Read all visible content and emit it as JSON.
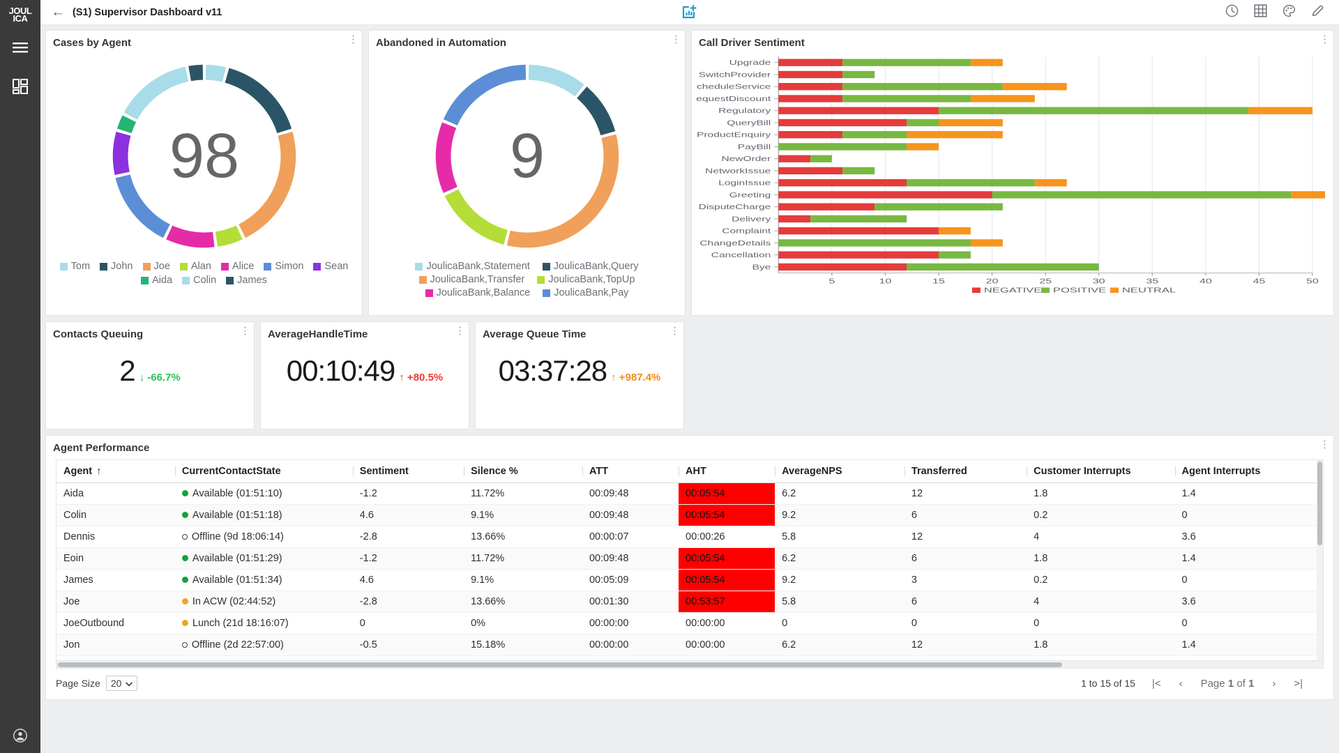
{
  "brand": {
    "logo_line1": "JOUL",
    "logo_line2": "ICA"
  },
  "rail": {
    "menu_icon": "hamburger-menu-icon",
    "dashboards_icon": "dashboard-grid-icon",
    "account_icon": "user-account-icon"
  },
  "topbar": {
    "back_label": "←",
    "title": "(S1) Supervisor Dashboard v11",
    "center_icon": "add-chart-icon",
    "center_icon_color": "#1b9fd0",
    "actions": [
      {
        "name": "clock-icon",
        "label": "history"
      },
      {
        "name": "grid-icon",
        "label": "layout"
      },
      {
        "name": "palette-icon",
        "label": "theme"
      },
      {
        "name": "pencil-icon",
        "label": "edit"
      }
    ]
  },
  "cards": {
    "cases_by_agent": {
      "title": "Cases by Agent"
    },
    "abandoned": {
      "title": "Abandoned in Automation"
    },
    "sentiment": {
      "title": "Call Driver Sentiment"
    },
    "agent_performance": {
      "title": "Agent Performance"
    }
  },
  "kpis": [
    {
      "title": "Contacts Queuing",
      "value": "2",
      "delta": "-66.7%",
      "arrow": "↓",
      "delta_color": "#23c552"
    },
    {
      "title": "AverageHandleTime",
      "value": "00:10:49",
      "delta": "+80.5%",
      "arrow": "↑",
      "delta_color": "#ef3b36"
    },
    {
      "title": "Average Queue Time",
      "value": "03:37:28",
      "delta": "+987.4%",
      "arrow": "↑",
      "delta_color": "#f08c1b"
    }
  ],
  "chart_data": [
    {
      "type": "pie",
      "title": "Cases by Agent",
      "center_value": "98",
      "legend_position": "bottom",
      "labels": [
        "Tom",
        "John",
        "Joe",
        "Alan",
        "Alice",
        "Simon",
        "Sean",
        "Aida",
        "Colin",
        "James"
      ],
      "values": [
        4,
        16,
        22,
        5,
        9,
        14,
        8,
        3,
        14,
        3
      ],
      "colors": [
        "#a8dce8",
        "#2b5566",
        "#f0a05a",
        "#b4dd38",
        "#e62ba8",
        "#5b8ed6",
        "#8c31e0",
        "#22b573",
        "#a8dce8",
        "#2b5566"
      ]
    },
    {
      "type": "pie",
      "title": "Abandoned in Automation",
      "center_value": "9",
      "legend_position": "bottom",
      "labels": [
        "JoulicaBank,Statement",
        "JoulicaBank,Query",
        "JoulicaBank,Transfer",
        "JoulicaBank,TopUp",
        "JoulicaBank,Balance",
        "JoulicaBank,Pay"
      ],
      "values": [
        10,
        9,
        30,
        13,
        12,
        17
      ],
      "colors": [
        "#a8dce8",
        "#2b5566",
        "#f0a05a",
        "#b4dd38",
        "#e62ba8",
        "#5b8ed6"
      ]
    },
    {
      "type": "bar",
      "orientation": "horizontal",
      "stacked": true,
      "title": "Call Driver Sentiment",
      "xlabel": "",
      "ylabel": "",
      "xlim": [
        0,
        50
      ],
      "xticks": [
        5,
        10,
        15,
        20,
        25,
        30,
        35,
        40,
        45,
        50
      ],
      "grid": true,
      "legend_position": "bottom",
      "categories": [
        "Upgrade",
        "SwitchProvider",
        "ScheduleService",
        "RequestDiscount",
        "Regulatory",
        "QueryBill",
        "ProductEnquiry",
        "PayBill",
        "NewOrder",
        "NetworkIssue",
        "LoginIssue",
        "Greeting",
        "DisputeCharge",
        "Delivery",
        "Complaint",
        "ChangeDetails",
        "Cancellation",
        "Bye"
      ],
      "series": [
        {
          "name": "NEGATIVE",
          "color": "#e43b3b",
          "values": [
            6,
            6,
            6,
            6,
            15,
            12,
            6,
            0,
            3,
            6,
            12,
            20,
            9,
            3,
            15,
            0,
            15,
            12
          ]
        },
        {
          "name": "POSITIVE",
          "color": "#78b842",
          "values": [
            12,
            3,
            15,
            12,
            29,
            3,
            6,
            12,
            2,
            3,
            12,
            28,
            12,
            9,
            0,
            18,
            3,
            18
          ]
        },
        {
          "name": "NEUTRAL",
          "color": "#f7941d",
          "values": [
            3,
            0,
            6,
            6,
            6,
            6,
            9,
            3,
            0,
            0,
            3,
            5,
            0,
            0,
            3,
            3,
            0,
            0
          ]
        }
      ]
    }
  ],
  "table": {
    "columns": [
      "Agent",
      "CurrentContactState",
      "Sentiment",
      "Silence %",
      "ATT",
      "AHT",
      "AverageNPS",
      "Transferred",
      "Customer Interrupts",
      "Agent Interrupts"
    ],
    "sort_column": "Agent",
    "sort_arrow": "↑",
    "rows": [
      {
        "agent": "Aida",
        "state": "Available (01:51:10)",
        "state_dot": "green",
        "sentiment": "-1.2",
        "silence": "11.72%",
        "att": "00:09:48",
        "aht": "00:05:54",
        "aht_alert": true,
        "nps": "6.2",
        "transferred": "12",
        "cust_int": "1.8",
        "agent_int": "1.4"
      },
      {
        "agent": "Colin",
        "state": "Available (01:51:18)",
        "state_dot": "green",
        "sentiment": "4.6",
        "silence": "9.1%",
        "att": "00:09:48",
        "aht": "00:05:54",
        "aht_alert": true,
        "nps": "9.2",
        "transferred": "6",
        "cust_int": "0.2",
        "agent_int": "0"
      },
      {
        "agent": "Dennis",
        "state": "Offline (9d 18:06:14)",
        "state_dot": "hollow",
        "sentiment": "-2.8",
        "silence": "13.66%",
        "att": "00:00:07",
        "aht": "00:00:26",
        "aht_alert": false,
        "nps": "5.8",
        "transferred": "12",
        "cust_int": "4",
        "agent_int": "3.6"
      },
      {
        "agent": "Eoin",
        "state": "Available (01:51:29)",
        "state_dot": "green",
        "sentiment": "-1.2",
        "silence": "11.72%",
        "att": "00:09:48",
        "aht": "00:05:54",
        "aht_alert": true,
        "nps": "6.2",
        "transferred": "6",
        "cust_int": "1.8",
        "agent_int": "1.4"
      },
      {
        "agent": "James",
        "state": "Available (01:51:34)",
        "state_dot": "green",
        "sentiment": "4.6",
        "silence": "9.1%",
        "att": "00:05:09",
        "aht": "00:05:54",
        "aht_alert": true,
        "nps": "9.2",
        "transferred": "3",
        "cust_int": "0.2",
        "agent_int": "0"
      },
      {
        "agent": "Joe",
        "state": "In ACW (02:44:52)",
        "state_dot": "orange",
        "sentiment": "-2.8",
        "silence": "13.66%",
        "att": "00:01:30",
        "aht": "00:53:57",
        "aht_alert": true,
        "nps": "5.8",
        "transferred": "6",
        "cust_int": "4",
        "agent_int": "3.6"
      },
      {
        "agent": "JoeOutbound",
        "state": "Lunch (21d 18:16:07)",
        "state_dot": "orange",
        "sentiment": "0",
        "silence": "0%",
        "att": "00:00:00",
        "aht": "00:00:00",
        "aht_alert": false,
        "nps": "0",
        "transferred": "0",
        "cust_int": "0",
        "agent_int": "0"
      },
      {
        "agent": "Jon",
        "state": "Offline (2d 22:57:00)",
        "state_dot": "hollow",
        "sentiment": "-0.5",
        "silence": "15.18%",
        "att": "00:00:00",
        "aht": "00:00:00",
        "aht_alert": false,
        "nps": "6.2",
        "transferred": "12",
        "cust_int": "1.8",
        "agent_int": "1.4"
      }
    ],
    "footer": {
      "page_size_label": "Page Size",
      "page_size_value": "20",
      "range_text_prefix": "1",
      "range_text": "1 to 15 of 15",
      "page_label_pre": "Page",
      "page_current": "1",
      "page_label_mid": "of",
      "page_total": "1",
      "first_icon": "|<",
      "prev_icon": "‹",
      "next_icon": "›",
      "last_icon": ">|"
    }
  }
}
